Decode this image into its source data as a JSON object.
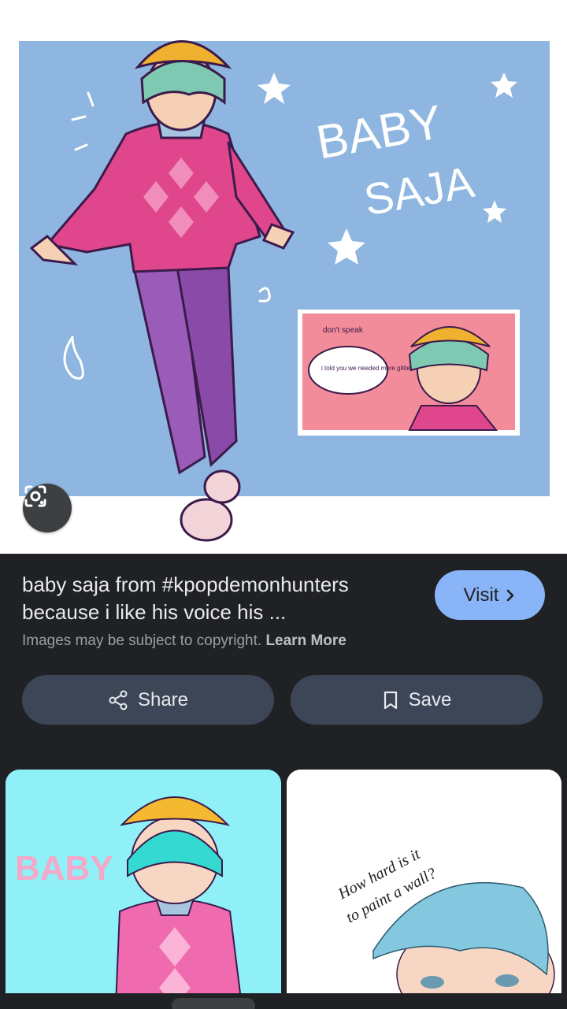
{
  "result": {
    "title": "baby saja from #kpopdemonhunters because i like his voice his ...",
    "visit_label": "Visit",
    "copyright_text": "Images may be subject to copyright.",
    "learn_more_label": "Learn More",
    "share_label": "Share",
    "save_label": "Save"
  },
  "artwork": {
    "main_text_line1": "BABY",
    "main_text_line2": "SAJA",
    "speech_bubble_text": "i told you we needed more glitter",
    "tagline_text": "don't speak"
  },
  "related": [
    {
      "art_text": "BABY"
    },
    {
      "art_text_line1": "How hard is it",
      "art_text_line2": "to paint a wall?"
    }
  ],
  "icons": {
    "lens": "lens-icon",
    "chevron": "chevron-right-icon",
    "share": "share-icon",
    "bookmark": "bookmark-icon"
  },
  "colors": {
    "background": "#202124",
    "visit_button": "#8ab4f8",
    "action_button": "#3c4657",
    "art_background": "#8fb6e0"
  }
}
